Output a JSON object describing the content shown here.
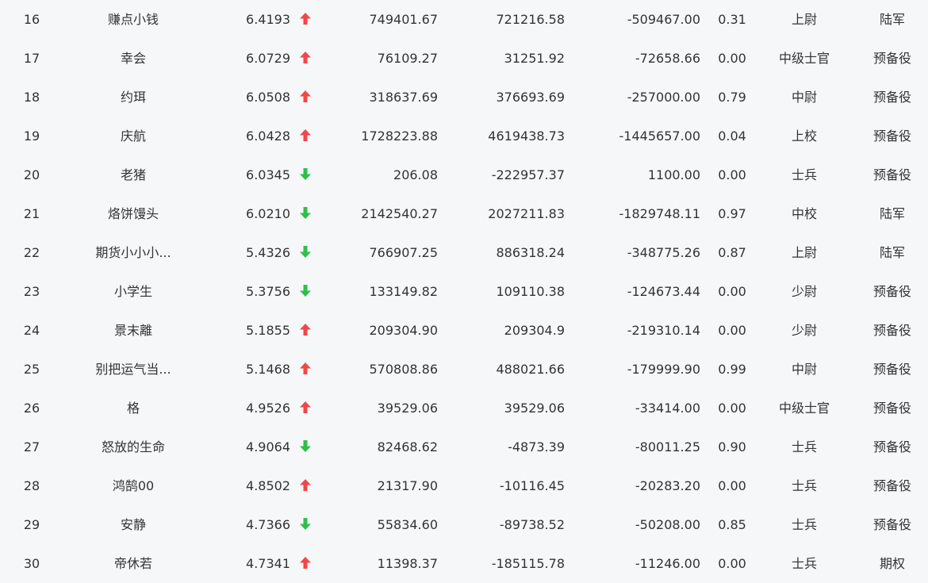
{
  "colors": {
    "up": "#f04848",
    "down": "#2fbf4a",
    "text": "#333333",
    "background": "#f6f7f9"
  },
  "icons": {
    "up": "arrow-up-icon",
    "down": "arrow-down-icon"
  },
  "rows": [
    {
      "rank": "16",
      "name": "赚点小钱",
      "score": "6.4193",
      "trend": "up",
      "col_a": "749401.67",
      "col_b": "721216.58",
      "col_c": "-509467.00",
      "ratio": "0.31",
      "rank_title": "上尉",
      "type": "陆军"
    },
    {
      "rank": "17",
      "name": "幸会",
      "score": "6.0729",
      "trend": "up",
      "col_a": "76109.27",
      "col_b": "31251.92",
      "col_c": "-72658.66",
      "ratio": "0.00",
      "rank_title": "中级士官",
      "type": "预备役"
    },
    {
      "rank": "18",
      "name": "约珥",
      "score": "6.0508",
      "trend": "up",
      "col_a": "318637.69",
      "col_b": "376693.69",
      "col_c": "-257000.00",
      "ratio": "0.79",
      "rank_title": "中尉",
      "type": "预备役"
    },
    {
      "rank": "19",
      "name": "庆航",
      "score": "6.0428",
      "trend": "up",
      "col_a": "1728223.88",
      "col_b": "4619438.73",
      "col_c": "-1445657.00",
      "ratio": "0.04",
      "rank_title": "上校",
      "type": "预备役"
    },
    {
      "rank": "20",
      "name": "老猪",
      "score": "6.0345",
      "trend": "down",
      "col_a": "206.08",
      "col_b": "-222957.37",
      "col_c": "1100.00",
      "ratio": "0.00",
      "rank_title": "士兵",
      "type": "预备役"
    },
    {
      "rank": "21",
      "name": "烙饼馒头",
      "score": "6.0210",
      "trend": "down",
      "col_a": "2142540.27",
      "col_b": "2027211.83",
      "col_c": "-1829748.11",
      "ratio": "0.97",
      "rank_title": "中校",
      "type": "陆军"
    },
    {
      "rank": "22",
      "name": "期货小小小...",
      "score": "5.4326",
      "trend": "down",
      "col_a": "766907.25",
      "col_b": "886318.24",
      "col_c": "-348775.26",
      "ratio": "0.87",
      "rank_title": "上尉",
      "type": "陆军"
    },
    {
      "rank": "23",
      "name": "小学生",
      "score": "5.3756",
      "trend": "down",
      "col_a": "133149.82",
      "col_b": "109110.38",
      "col_c": "-124673.44",
      "ratio": "0.00",
      "rank_title": "少尉",
      "type": "预备役"
    },
    {
      "rank": "24",
      "name": "景末離",
      "score": "5.1855",
      "trend": "up",
      "col_a": "209304.90",
      "col_b": "209304.9",
      "col_c": "-219310.14",
      "ratio": "0.00",
      "rank_title": "少尉",
      "type": "预备役"
    },
    {
      "rank": "25",
      "name": "别把运气当...",
      "score": "5.1468",
      "trend": "up",
      "col_a": "570808.86",
      "col_b": "488021.66",
      "col_c": "-179999.90",
      "ratio": "0.99",
      "rank_title": "中尉",
      "type": "预备役"
    },
    {
      "rank": "26",
      "name": "格",
      "score": "4.9526",
      "trend": "up",
      "col_a": "39529.06",
      "col_b": "39529.06",
      "col_c": "-33414.00",
      "ratio": "0.00",
      "rank_title": "中级士官",
      "type": "预备役"
    },
    {
      "rank": "27",
      "name": "怒放的生命",
      "score": "4.9064",
      "trend": "down",
      "col_a": "82468.62",
      "col_b": "-4873.39",
      "col_c": "-80011.25",
      "ratio": "0.90",
      "rank_title": "士兵",
      "type": "预备役"
    },
    {
      "rank": "28",
      "name": "鸿鹄00",
      "score": "4.8502",
      "trend": "up",
      "col_a": "21317.90",
      "col_b": "-10116.45",
      "col_c": "-20283.20",
      "ratio": "0.00",
      "rank_title": "士兵",
      "type": "预备役"
    },
    {
      "rank": "29",
      "name": "安静",
      "score": "4.7366",
      "trend": "down",
      "col_a": "55834.60",
      "col_b": "-89738.52",
      "col_c": "-50208.00",
      "ratio": "0.85",
      "rank_title": "士兵",
      "type": "预备役"
    },
    {
      "rank": "30",
      "name": "帝休若",
      "score": "4.7341",
      "trend": "up",
      "col_a": "11398.37",
      "col_b": "-185115.78",
      "col_c": "-11246.00",
      "ratio": "0.00",
      "rank_title": "士兵",
      "type": "期权"
    }
  ]
}
